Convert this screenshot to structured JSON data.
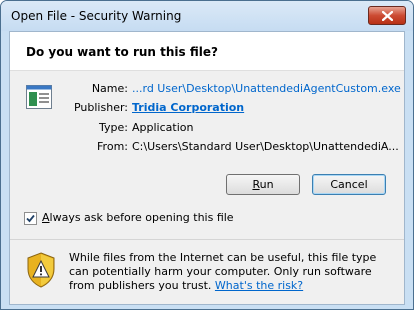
{
  "window": {
    "title": "Open File - Security Warning"
  },
  "header": {
    "question": "Do you want to run this file?"
  },
  "fields": [
    {
      "label": "Name:",
      "value": "...rd User\\Desktop\\UnattendediAgentCustom.exe"
    },
    {
      "label": "Publisher:",
      "value": "Tridia Corporation"
    },
    {
      "label": "Type:",
      "value": "Application"
    },
    {
      "label": "From:",
      "value": "C:\\Users\\Standard User\\Desktop\\UnattendediA..."
    }
  ],
  "buttons": {
    "run_prefix": "",
    "run_accel": "R",
    "run_rest": "un",
    "cancel": "Cancel"
  },
  "checkbox": {
    "checked": true,
    "label_prefix": "",
    "label_accel": "A",
    "label_rest": "lways ask before opening this file"
  },
  "warning": {
    "text": "While files from the Internet can be useful, this file type can potentially harm your computer. Only run software from publishers you trust.",
    "link": "What's the risk?"
  },
  "icons": {
    "file": "application-file-icon",
    "shield": "warning-shield-icon",
    "close": "close-icon",
    "check": "checkmark-icon"
  },
  "colors": {
    "link": "#0066cc",
    "close_button": "#c7432b",
    "frame": "#c9dff3"
  }
}
